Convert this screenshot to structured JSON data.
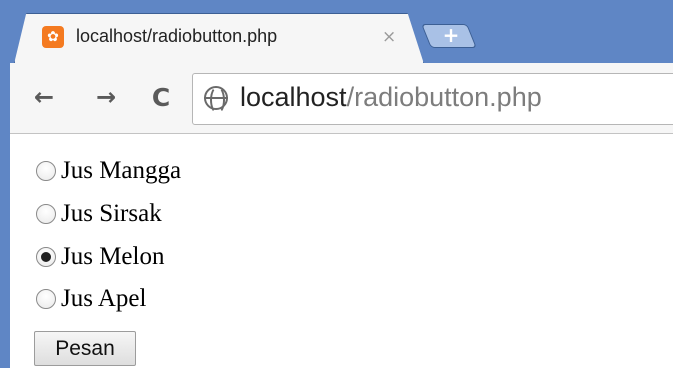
{
  "browser": {
    "tab": {
      "favicon_glyph": "✿",
      "title": "localhost/radiobutton.php",
      "close_glyph": "×"
    },
    "new_tab_glyph": "+",
    "nav": {
      "back_glyph": "←",
      "forward_glyph": "→",
      "reload_glyph": "C"
    },
    "address": {
      "host": "localhost",
      "path": "/radiobutton.php"
    }
  },
  "form": {
    "options": [
      {
        "label": "Jus Mangga",
        "checked": false
      },
      {
        "label": "Jus Sirsak",
        "checked": false
      },
      {
        "label": "Jus Melon",
        "checked": true
      },
      {
        "label": "Jus Apel",
        "checked": false
      }
    ],
    "submit_label": "Pesan"
  },
  "colors": {
    "window_frame": "#5f86c5",
    "favicon": "#f47a20"
  }
}
